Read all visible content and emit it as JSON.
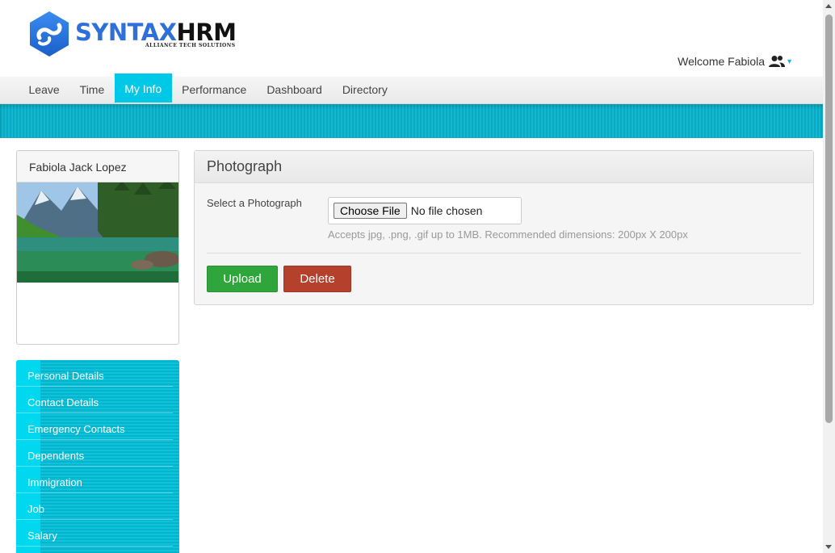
{
  "header": {
    "logo_primary": "SYNTAX",
    "logo_secondary": "HRM",
    "logo_tagline": "ALLIANCE TECH SOLUTIONS",
    "welcome_text": "Welcome Fabiola",
    "user_menu_icon": "users-icon"
  },
  "nav": {
    "items": [
      {
        "label": "Leave"
      },
      {
        "label": "Time"
      },
      {
        "label": "My Info",
        "active": true
      },
      {
        "label": "Performance"
      },
      {
        "label": "Dashboard"
      },
      {
        "label": "Directory"
      }
    ]
  },
  "profile": {
    "name": "Fabiola Jack Lopez",
    "photo": "mountain-lake-photo"
  },
  "side_menu": {
    "items": [
      {
        "label": "Personal Details"
      },
      {
        "label": "Contact Details"
      },
      {
        "label": "Emergency Contacts"
      },
      {
        "label": "Dependents"
      },
      {
        "label": "Immigration"
      },
      {
        "label": "Job"
      },
      {
        "label": "Salary"
      }
    ]
  },
  "photo_panel": {
    "title": "Photograph",
    "field_label": "Select a Photograph",
    "choose_file_label": "Choose File",
    "file_status": "No file chosen",
    "help_text": "Accepts jpg, .png, .gif up to 1MB. Recommended dimensions: 200px X 200px",
    "upload_label": "Upload",
    "delete_label": "Delete"
  },
  "colors": {
    "accent": "#00c8e6",
    "upload": "#2fa63c",
    "delete": "#b5412d",
    "logo_blue": "#2f6fd8"
  }
}
